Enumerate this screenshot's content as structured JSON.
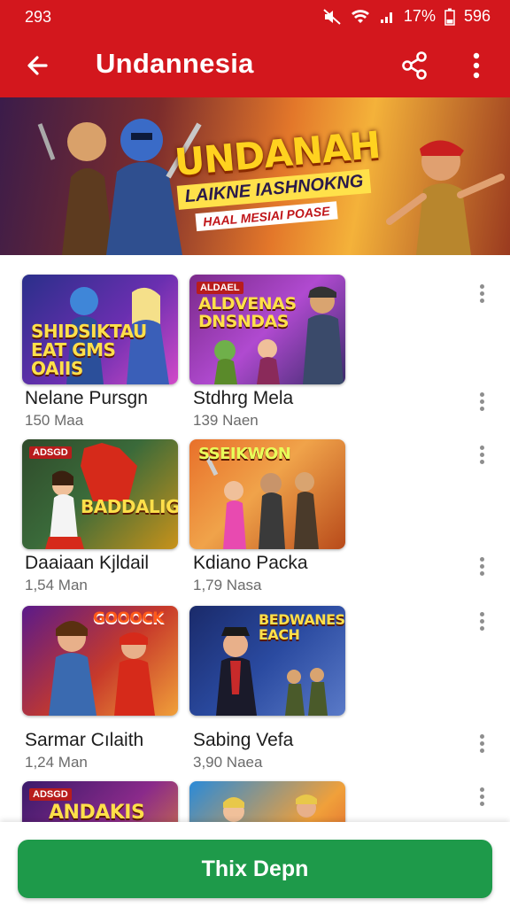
{
  "status": {
    "time": "293",
    "battery_pct": "17%",
    "signal_text": "596"
  },
  "appbar": {
    "title": "Undannesia",
    "icons": [
      "back-arrow-icon",
      "share-icon",
      "more-vert-icon"
    ]
  },
  "banner": {
    "headline": "UNDANAH",
    "subhead": "LAIKNE IASHNOKNG",
    "tagline": "HAAL MESIAI POASE"
  },
  "items": [
    {
      "title": "Nelane Pursgn",
      "meta": "150 Maa",
      "art_text": "SHIDSIKTAU EAT GMS OAIIS",
      "tag": ""
    },
    {
      "title": "Stdhrg Mela",
      "meta": "139 Naen",
      "art_text": "ALDVENAS DNSNDAS",
      "tag": "ALDAEL"
    },
    {
      "title": "Daaiaan Kjldail",
      "meta": "1,54 Man",
      "art_text": "BADDALIG",
      "tag": "ADSGD"
    },
    {
      "title": "Kdiano Packa",
      "meta": "1,79 Nasa",
      "art_text": "SSEIKWON",
      "tag": ""
    },
    {
      "title": "Sarmar Cılaith",
      "meta": "1,24 Man",
      "art_text": "GOOOCK",
      "tag": ""
    },
    {
      "title": "Sabing Vefa",
      "meta": "3,90 Naea",
      "art_text": "BEDWANES EACH",
      "tag": ""
    },
    {
      "title": "",
      "meta": "",
      "art_text": "ANDAKIS",
      "tag": "ADSGD"
    },
    {
      "title": "",
      "meta": "",
      "art_text": "",
      "tag": ""
    }
  ],
  "cta": {
    "label": "Thix Depn"
  },
  "colors": {
    "brand_red": "#d3171d",
    "cta_green": "#1e9a4a"
  }
}
